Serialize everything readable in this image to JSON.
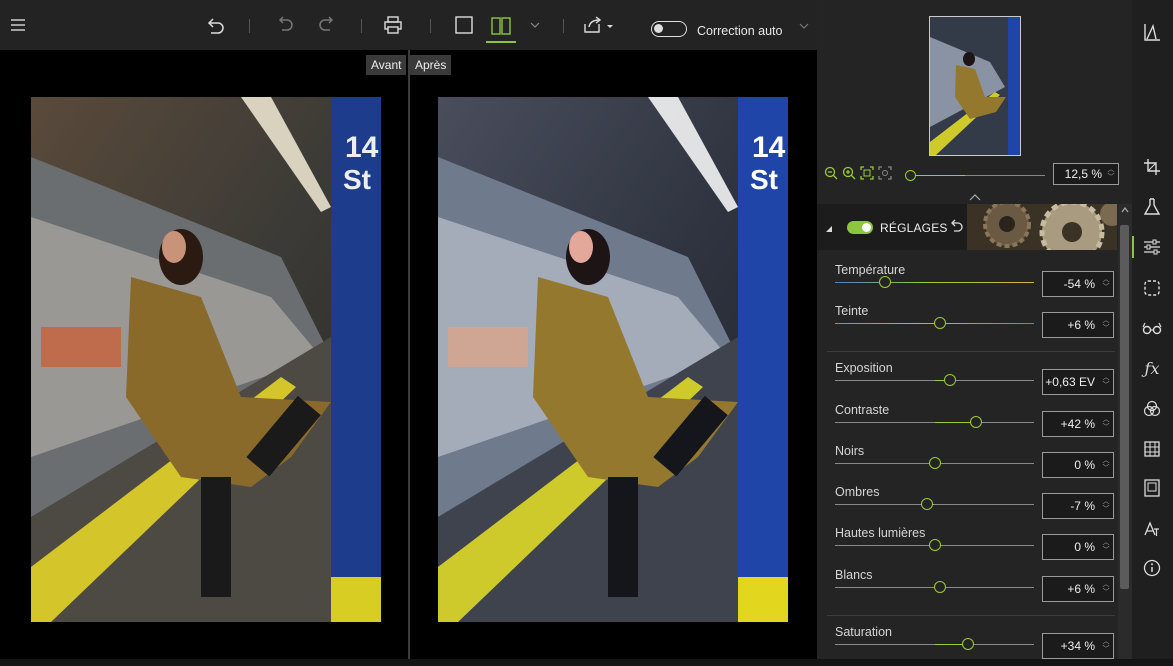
{
  "toolbar": {
    "auto_correction_label": "Correction auto"
  },
  "viewer": {
    "before_label": "Avant",
    "after_label": "Après"
  },
  "navigator": {
    "zoom_value": "12,5 %",
    "zoom_level": 0.125
  },
  "adjustments": {
    "title": "RÉGLAGES",
    "enabled": true,
    "sliders": [
      {
        "label": "Température",
        "value": "-54 %",
        "pos": 0.25,
        "track": "temp"
      },
      {
        "label": "Teinte",
        "value": "+6 %",
        "pos": 0.53,
        "track": "tint"
      },
      {
        "label": "Exposition",
        "value": "+0,63 EV",
        "pos": 0.58,
        "track": "plain"
      },
      {
        "label": "Contraste",
        "value": "+42 %",
        "pos": 0.71,
        "track": "plain"
      },
      {
        "label": "Noirs",
        "value": "0 %",
        "pos": 0.5,
        "track": "plain"
      },
      {
        "label": "Ombres",
        "value": "-7 %",
        "pos": 0.46,
        "track": "plain"
      },
      {
        "label": "Hautes lumières",
        "value": "0 %",
        "pos": 0.5,
        "track": "plain"
      },
      {
        "label": "Blancs",
        "value": "+6 %",
        "pos": 0.53,
        "track": "plain"
      },
      {
        "label": "Saturation",
        "value": "+34 %",
        "pos": 0.67,
        "track": "plain"
      }
    ]
  },
  "colors": {
    "accent": "#8cc63f",
    "panel_bg": "#242424",
    "toolbar_bg": "#232323",
    "viewer_bg": "#000000"
  },
  "icons": {
    "toolbar": [
      "menu-icon",
      "undo-all-icon",
      "undo-icon",
      "redo-icon",
      "print-icon",
      "single-view-icon",
      "split-view-icon",
      "chevron-down-icon",
      "export-icon"
    ],
    "sidebar": [
      "histogram-icon",
      "crop-icon",
      "lab-flask-icon",
      "sliders-icon",
      "selection-icon",
      "glasses-icon",
      "fx-icon",
      "color-wheels-icon",
      "grid-icon",
      "frame-icon",
      "text-icon",
      "info-icon"
    ]
  }
}
